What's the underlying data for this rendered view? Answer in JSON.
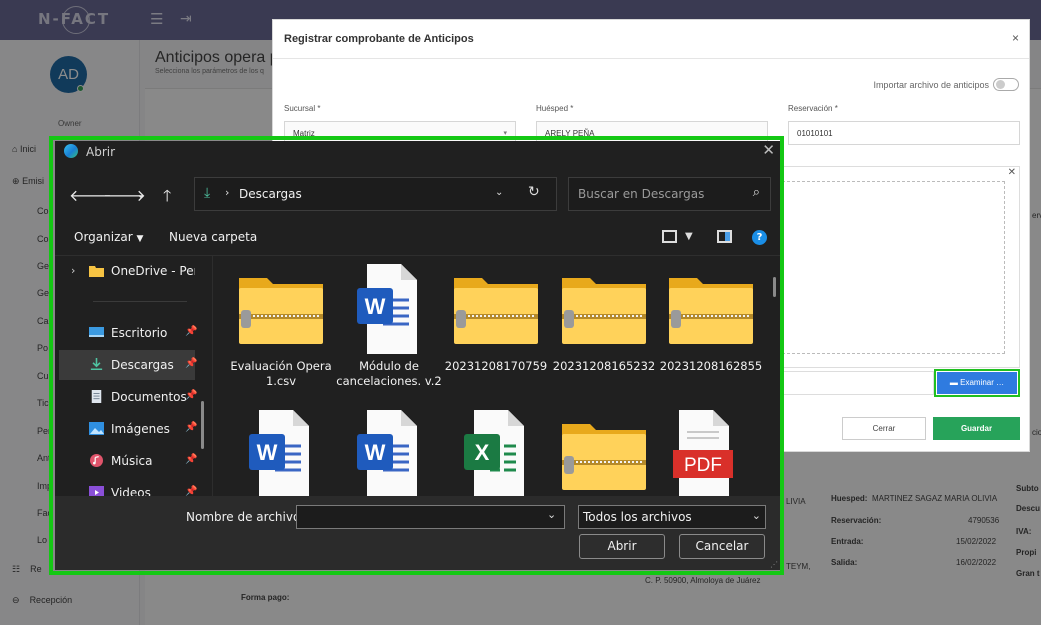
{
  "app": {
    "logo": "N-FACT",
    "avatar": "AD",
    "role": "Owner",
    "sidebar": [
      "Inici",
      "Emisi",
      "Re",
      "Recepción"
    ],
    "sidebar_sub": [
      "Co",
      "Co",
      "Ge",
      "Ge",
      "Ca",
      "Po",
      "Cu",
      "Tic",
      "Per",
      "Ant",
      "Imp",
      "Fac",
      "Lo"
    ],
    "page_title": "Anticipos opera p",
    "page_subtitle": "Selecciona los parámetros de los q",
    "bg": {
      "huesped_label": "Huesped:",
      "huesped_value": "MARTINEZ SAGAZ MARIA OLIVIA",
      "olivia": "LIVIA",
      "reservacion_label": "Reservación:",
      "reservacion_value": "4790536",
      "entrada_label": "Entrada:",
      "entrada_value": "15/02/2022",
      "salida_label": "Salida:",
      "salida_value": "16/02/2022",
      "subto": "Subto",
      "descu": "Descu",
      "iva": "IVA:",
      "propi": "Propi",
      "grant": "Gran t",
      "teym": "TEYM,",
      "direccion": "C. P. 50900, Almoloya de Juárez",
      "forma_pago": "Forma pago:",
      "serva": "erva",
      "cio": "cio"
    }
  },
  "modal": {
    "title": "Registrar comprobante de Anticipos",
    "close": "×",
    "import_label": "Importar archivo de anticipos",
    "sucursal_label": "Sucursal *",
    "sucursal_value": "Matriz",
    "huesped_label": "Huésped *",
    "huesped_value": "ARELY PEÑA",
    "reservacion_label": "Reservación *",
    "reservacion_value": "01010101",
    "examinar": "Examinar …",
    "cerrar": "Cerrar",
    "guardar": "Guardar"
  },
  "dialog": {
    "title": "Abrir",
    "close": "✕",
    "address": "Descargas",
    "search_placeholder": "Buscar en Descargas",
    "organize": "Organizar",
    "new_folder": "Nueva carpeta",
    "nav": [
      {
        "label": "OneDrive - Perso",
        "icon": "folder-icon"
      },
      {
        "label": "Escritorio",
        "icon": "desktop-icon"
      },
      {
        "label": "Descargas",
        "icon": "download-icon"
      },
      {
        "label": "Documentos",
        "icon": "document-icon"
      },
      {
        "label": "Imágenes",
        "icon": "picture-icon"
      },
      {
        "label": "Música",
        "icon": "music-icon"
      },
      {
        "label": "Videos",
        "icon": "video-icon"
      }
    ],
    "files": [
      {
        "name": "Evaluación Opera 1.csv",
        "type": "zip-folder"
      },
      {
        "name": "Módulo de cancelaciones. v.2",
        "type": "word"
      },
      {
        "name": "20231208170759",
        "type": "zip-folder"
      },
      {
        "name": "20231208165232",
        "type": "zip-folder"
      },
      {
        "name": "20231208162855",
        "type": "zip-folder"
      },
      {
        "name": "",
        "type": "word"
      },
      {
        "name": "",
        "type": "word"
      },
      {
        "name": "",
        "type": "excel"
      },
      {
        "name": "",
        "type": "zip-folder"
      },
      {
        "name": "",
        "type": "pdf"
      }
    ],
    "filename_label": "Nombre de archivo:",
    "filename_value": "",
    "file_type": "Todos los archivos",
    "open": "Abrir",
    "cancel": "Cancelar"
  },
  "colors": {
    "highlight": "#14c814",
    "accent": "#2f7be0",
    "save": "#27a35a"
  }
}
